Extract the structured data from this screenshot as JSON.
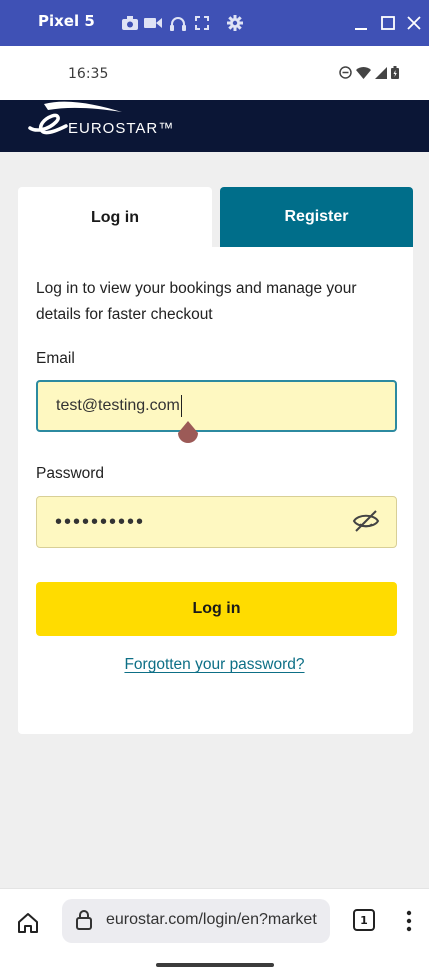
{
  "emulator": {
    "title": "Pixel 5",
    "icons": [
      "camera-icon",
      "video-icon",
      "headphones-icon",
      "fullscreen-icon",
      "settings-icon"
    ],
    "window_controls": [
      "minimize-icon",
      "maximize-icon",
      "close-icon"
    ]
  },
  "status_bar": {
    "time": "16:35",
    "icons": [
      "do-not-disturb-icon",
      "wifi-icon",
      "signal-icon",
      "battery-icon"
    ]
  },
  "brand": {
    "logo_text": "EUROSTAR™",
    "colors": {
      "navy": "#0b1636",
      "teal": "#006e8a",
      "yellow": "#ffdc00",
      "field": "#fef8c1"
    }
  },
  "tabs": [
    {
      "label": "Log in",
      "active": true
    },
    {
      "label": "Register",
      "active": false
    }
  ],
  "form": {
    "intro": "Log in to view your bookings and manage your details for faster checkout",
    "email_label": "Email",
    "email_value": "test@testing.com",
    "password_label": "Password",
    "password_value": "••••••••••",
    "submit_label": "Log in",
    "forgot_link": "Forgotten your password?"
  },
  "browser": {
    "url": "eurostar.com/login/en?market",
    "tab_count": "1"
  }
}
